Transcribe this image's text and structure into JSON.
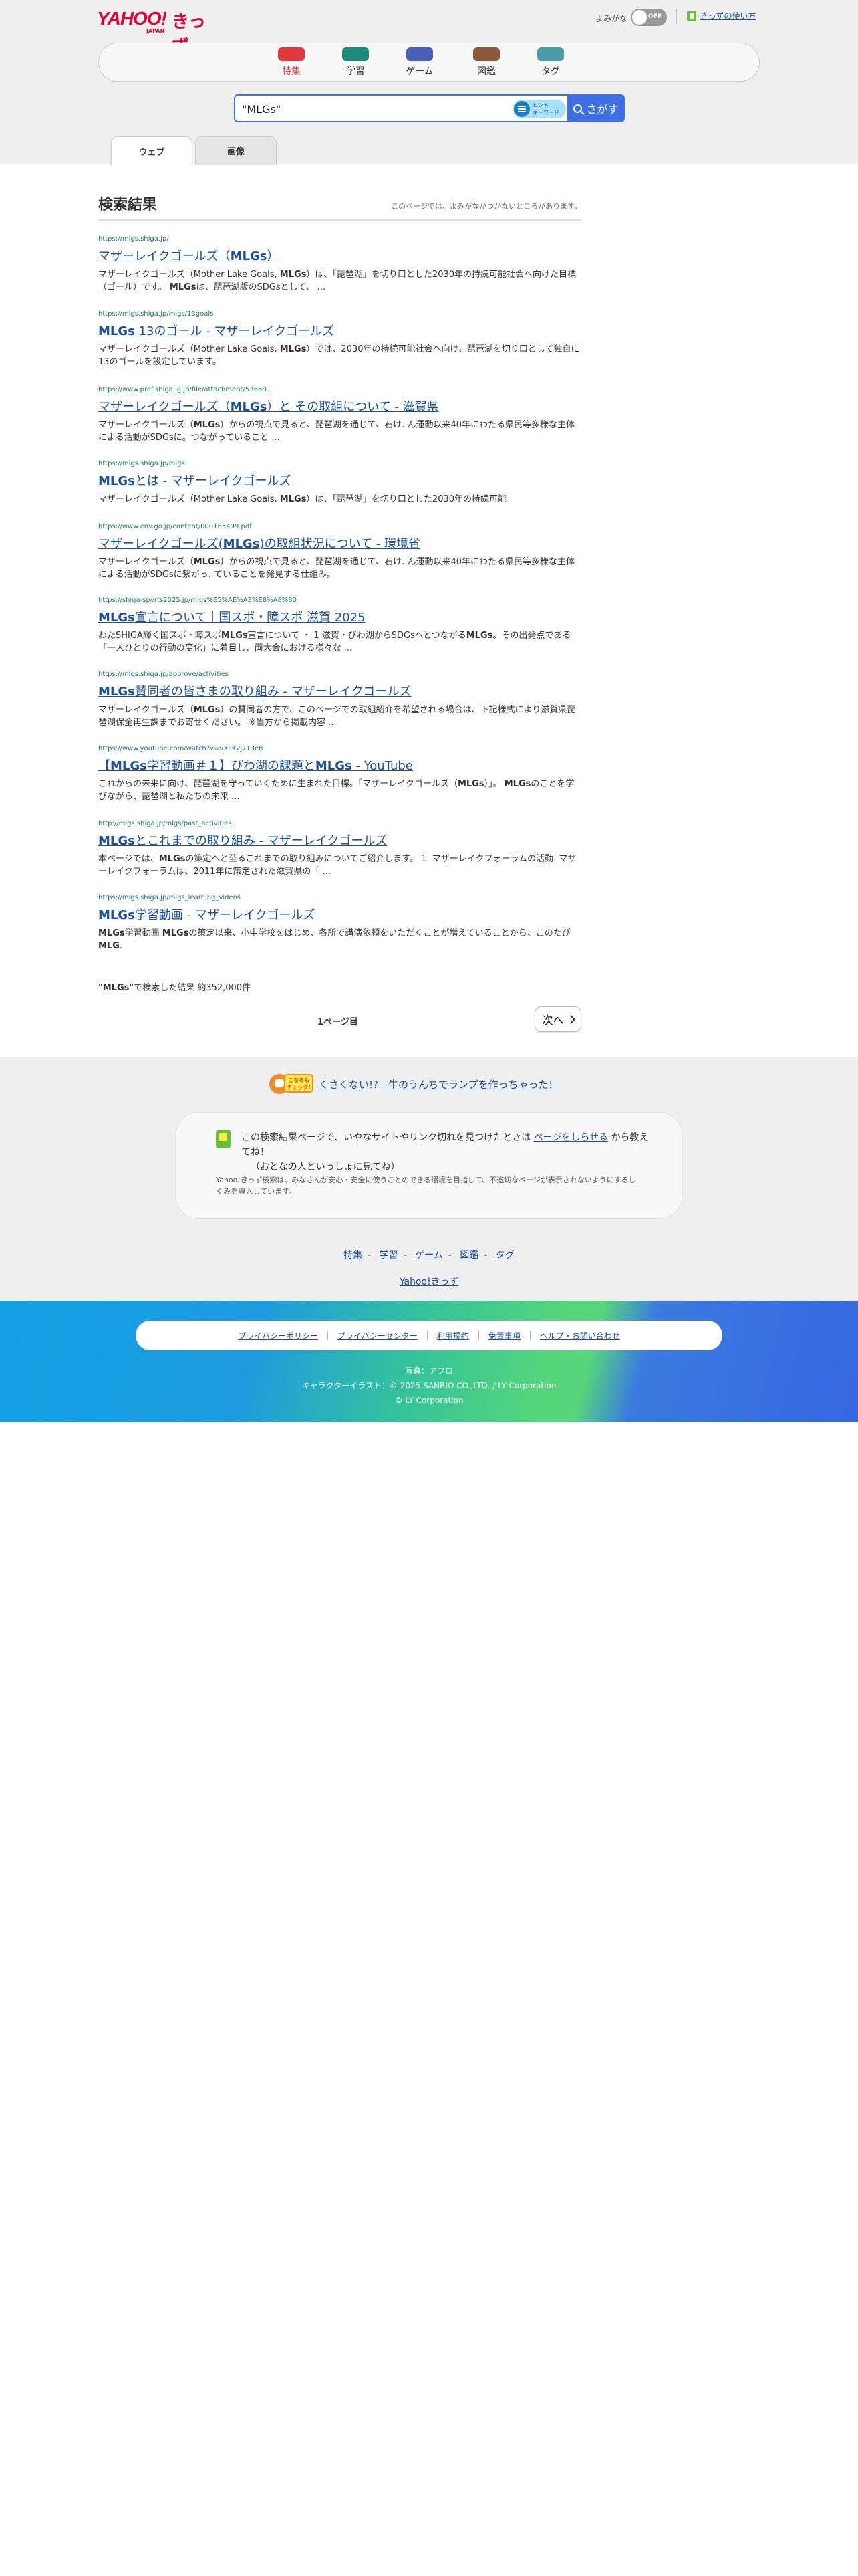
{
  "header": {
    "logo_main": "YAHOO!",
    "logo_kids": "きっず",
    "logo_sub": "JAPAN",
    "hiragana_label": "よみがな",
    "toggle_state": "OFF",
    "guide_link": "きっずの使い方"
  },
  "categories": [
    {
      "label": "特集",
      "color": "#e2373f",
      "text_color": "#e2373f"
    },
    {
      "label": "学習",
      "color": "#1e8a7a",
      "text_color": "#333333"
    },
    {
      "label": "ゲーム",
      "color": "#4a5fb8",
      "text_color": "#333333"
    },
    {
      "label": "図鑑",
      "color": "#8b5a3c",
      "text_color": "#333333"
    },
    {
      "label": "タグ",
      "color": "#4a9da8",
      "text_color": "#333333"
    }
  ],
  "search": {
    "query": "\"MLGs\"",
    "assist_text": "ヒント\nキーワード",
    "button_label": "さがす"
  },
  "tabs": [
    {
      "label": "ウェブ",
      "active": true
    },
    {
      "label": "画像",
      "active": false
    }
  ],
  "results_header": {
    "title": "検索結果",
    "note": "このページでは、よみがながつかないところがあります。"
  },
  "results": [
    {
      "url": "https://mlgs.shiga.jp/",
      "title": "マザーレイクゴールズ（<b>MLGs</b>）",
      "snippet": "マザーレイクゴールズ（Mother Lake Goals, <b>MLGs</b>）は、「琵琶湖」を切り口とした2030年の持続可能社会へ向けた目標（ゴール）です。 <b>MLGs</b>は、琵琶湖版のSDGsとして、 ..."
    },
    {
      "url": "https://mlgs.shiga.jp/mlgs/13goals",
      "title": "<b>MLGs</b> 13のゴール - マザーレイクゴールズ",
      "snippet": "マザーレイクゴールズ（Mother Lake Goals, <b>MLGs</b>）では、2030年の持続可能社会へ向け、琵琶湖を切り口として独自に13のゴールを設定しています。"
    },
    {
      "url": "https://www.pref.shiga.lg.jp/file/attachment/53668...",
      "title": "マザーレイクゴールズ（<b>MLGs</b>）と その取組について - 滋賀県",
      "snippet": "マザーレイクゴールズ（<b>MLGs</b>）からの視点で見ると、琵琶湖を通じて、石け. ん運動以来40年にわたる県民等多様な主体による活動がSDGsに。つながっていること ..."
    },
    {
      "url": "https://mlgs.shiga.jp/mlgs",
      "title": "<b>MLGs</b>とは - マザーレイクゴールズ",
      "snippet": "マザーレイクゴールズ（Mother Lake Goals, <b>MLGs</b>）は、「琵琶湖」を切り口とした2030年の持続可能"
    },
    {
      "url": "https://www.env.go.jp/content/000165499.pdf",
      "title": "マザーレイクゴールズ(<b>MLGs</b>)の取組状況について - 環境省",
      "snippet": "マザーレイクゴールズ（<b>MLGs</b>）からの視点で見ると、琵琶湖を通じて、石け. ん運動以来40年にわたる県民等多様な主体による活動がSDGsに繋がっ. ていることを発見する仕組み。"
    },
    {
      "url": "https://shiga-sports2025.jp/mlgs%E5%AE%A3%E8%A8%80",
      "title": "<b>MLGs</b>宣言について｜国スポ・障スポ 滋賀 2025",
      "snippet": "わたSHIGA輝く国スポ・障スポ<b>MLGs</b>宣言について ・ 1 滋賀・びわ湖からSDGsへとつながる<b>MLGs</b>。その出発点である「一人ひとりの行動の変化」に着目し、両大会における様々な ..."
    },
    {
      "url": "https://mlgs.shiga.jp/approve/activities",
      "title": "<b>MLGs</b>賛同者の皆さまの取り組み - マザーレイクゴールズ",
      "snippet": "マザーレイクゴールズ（<b>MLGs</b>）の賛同者の方で、このページでの取組紹介を希望される場合は、下記様式により滋賀県琵琶湖保全再生課までお寄せください。 ※当方から掲載内容 ..."
    },
    {
      "url": "https://www.youtube.com/watch?v=vXFKvj7T3e8",
      "title": "【<b>MLGs</b>学習動画＃１】びわ湖の課題と<b>MLGs</b> - YouTube",
      "snippet": "これからの未来に向け、琵琶湖を守っていくために生まれた目標。「マザーレイクゴールズ（<b>MLGs</b>）」。 <b>MLGs</b>のことを学びながら、琵琶湖と私たちの未来 ..."
    },
    {
      "url": "http://mlgs.shiga.jp/mlgs/past_activities",
      "title": "<b>MLGs</b>とこれまでの取り組み - マザーレイクゴールズ",
      "snippet": "本ページでは、<b>MLGs</b>の策定へと至るこれまでの取り組みについてご紹介します。 1. マザーレイクフォーラムの活動. マザーレイクフォーラムは、2011年に策定された滋賀県の「 ..."
    },
    {
      "url": "https://mlgs.shiga.jp/mlgs_learning_videos",
      "title": "<b>MLGs</b>学習動画 - マザーレイクゴールズ",
      "snippet": "<b>MLGs</b>学習動画 <b>MLGs</b>の策定以来、小中学校をはじめ、各所で講演依頼をいただくことが増えていることから、このたび<b>MLG</b>."
    }
  ],
  "result_count": "\"MLGs\"で検索した結果 約352,000件",
  "pager": {
    "page_label": "1ページ目",
    "next_label": "次へ"
  },
  "promo": {
    "badge_text": "こちらも\nチェック!",
    "link_text": "くさくない!?　牛のうんちでランプを作っちゃった！"
  },
  "report": {
    "text_before": "この検索結果ページで、いやなサイトやリンク切れを見つけたときは ",
    "link_text": "ページをしらせる",
    "text_after": " から教えてね！",
    "line2": "（おとなの人といっしょに見てね）",
    "sub": "Yahoo!きっず検索は、みなさんが安心・安全に使うことのできる環境を目指して、不適切なページが表示されないようにするしくみを導入しています。"
  },
  "bottom_nav": [
    "特集",
    "学習",
    "ゲーム",
    "図鑑",
    "タグ"
  ],
  "home_link": "Yahoo!きっず",
  "footer": {
    "links": [
      "プライバシーポリシー",
      "プライバシーセンター",
      "利用規約",
      "免責事項",
      "ヘルプ・お問い合わせ"
    ],
    "credit1": "写真：アフロ",
    "credit2": "キャラクターイラスト：© 2025 SANRIO CO.,LTD. / LY Corporation",
    "credit3": "© LY Corporation"
  }
}
